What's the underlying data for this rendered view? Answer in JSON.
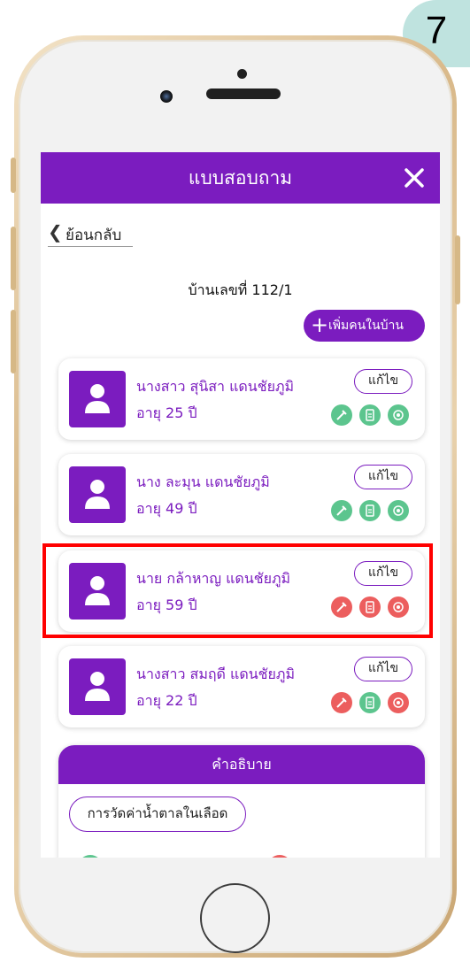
{
  "step": "7",
  "app": {
    "title": "แบบสอบถาม",
    "back_label": "ย้อนกลับ",
    "house_label": "บ้านเลขที่ 112/1",
    "add_button": "เพิ่มคนในบ้าน",
    "edit_label": "แก้ไข"
  },
  "people": [
    {
      "name": "นางสาว สุนิสา แดนชัยภูมิ",
      "age": "อายุ 25 ปี",
      "status": [
        "green",
        "green",
        "green"
      ]
    },
    {
      "name": "นาง ละมุน แดนชัยภูมิ",
      "age": "อายุ 49 ปี",
      "status": [
        "green",
        "green",
        "green"
      ]
    },
    {
      "name": "นาย กล้าหาญ แดนชัยภูมิ",
      "age": "อายุ 59 ปี",
      "status": [
        "red",
        "red",
        "red"
      ],
      "highlighted": true
    },
    {
      "name": "นางสาว สมฤดี แดนชัยภูมิ",
      "age": "อายุ 22 ปี",
      "status": [
        "red",
        "green",
        "red"
      ]
    }
  ],
  "legend": {
    "title": "คำอธิบาย",
    "blood_sugar_label": "การวัดค่าน้ำตาลในเลือด"
  },
  "colors": {
    "purple": "#7b1cbf",
    "status_green": "#5cc58e",
    "status_red": "#ec5e5e",
    "highlight": "#ff0000",
    "badge": "#bfe3df"
  },
  "icons": [
    "close-icon",
    "chevron-left-icon",
    "plus-icon",
    "person-icon",
    "syringe-icon",
    "document-icon",
    "stethoscope-icon"
  ]
}
